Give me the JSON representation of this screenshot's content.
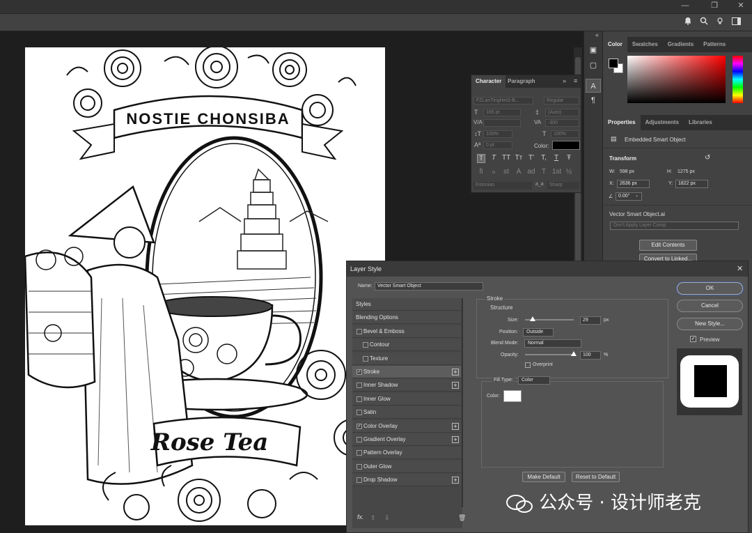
{
  "window": {
    "min": "—",
    "restore": "❐",
    "close": "✕"
  },
  "canvas": {
    "banner_text": "NOSTIE CHONSIBA",
    "tagline": "Rose Tea"
  },
  "tools": [
    "▣",
    "▢",
    "A",
    "¶"
  ],
  "character": {
    "tabs": [
      "Character",
      "Paragraph"
    ],
    "font_family": "FZLanTingHeiS-B...",
    "font_style": "Regular",
    "size": "165 pt",
    "leading": "(Auto)",
    "kerning": "",
    "tracking": "-300",
    "vscale": "100%",
    "hscale": "100%",
    "baseline": "0 pt",
    "color_label": "Color:",
    "language": "Estonian",
    "aa": "a_a",
    "antialias": "Sharp",
    "style_glyphs": [
      "T",
      "T",
      "TT",
      "Tт",
      "T'",
      "T,",
      "T",
      "Ŧ"
    ],
    "ot_glyphs": [
      "fi",
      "ℴ",
      "st",
      "A",
      "ad",
      "T",
      "1st",
      "½"
    ]
  },
  "color_panel": {
    "tabs": [
      "Color",
      "Swatches",
      "Gradients",
      "Patterns"
    ]
  },
  "properties": {
    "tabs": [
      "Properties",
      "Adjustments",
      "Libraries"
    ],
    "type": "Embedded Smart Object",
    "transform_label": "Transform",
    "w_label": "W:",
    "w": "598 px",
    "h_label": "H:",
    "h": "1275 px",
    "x_label": "X:",
    "x": "2636 px",
    "y_label": "Y:",
    "y": "1822 px",
    "angle": "0.00°",
    "file": "Vector Smart Object.ai",
    "layer_comp": "Don't Apply Layer Comp",
    "edit_contents": "Edit Contents",
    "convert": "Convert to Linked..."
  },
  "dialog": {
    "title": "Layer Style",
    "name_label": "Name:",
    "name_value": "Vector Smart Object",
    "styles": [
      {
        "label": "Styles",
        "checkbox": false,
        "checked": false,
        "plus": false,
        "indent": 0
      },
      {
        "label": "Blending Options",
        "checkbox": false,
        "checked": false,
        "plus": false,
        "indent": 0
      },
      {
        "label": "Bevel & Emboss",
        "checkbox": true,
        "checked": false,
        "plus": false,
        "indent": 0
      },
      {
        "label": "Contour",
        "checkbox": true,
        "checked": false,
        "plus": false,
        "indent": 1
      },
      {
        "label": "Texture",
        "checkbox": true,
        "checked": false,
        "plus": false,
        "indent": 1
      },
      {
        "label": "Stroke",
        "checkbox": true,
        "checked": true,
        "plus": true,
        "indent": 0,
        "selected": true
      },
      {
        "label": "Inner Shadow",
        "checkbox": true,
        "checked": false,
        "plus": true,
        "indent": 0
      },
      {
        "label": "Inner Glow",
        "checkbox": true,
        "checked": false,
        "plus": false,
        "indent": 0
      },
      {
        "label": "Satin",
        "checkbox": true,
        "checked": false,
        "plus": false,
        "indent": 0
      },
      {
        "label": "Color Overlay",
        "checkbox": true,
        "checked": true,
        "plus": true,
        "indent": 0
      },
      {
        "label": "Gradient Overlay",
        "checkbox": true,
        "checked": false,
        "plus": true,
        "indent": 0
      },
      {
        "label": "Pattern Overlay",
        "checkbox": true,
        "checked": false,
        "plus": false,
        "indent": 0
      },
      {
        "label": "Outer Glow",
        "checkbox": true,
        "checked": false,
        "plus": false,
        "indent": 0
      },
      {
        "label": "Drop Shadow",
        "checkbox": true,
        "checked": false,
        "plus": true,
        "indent": 0
      }
    ],
    "fx": "fx.",
    "stroke": {
      "heading": "Stroke",
      "structure": "Structure",
      "size_label": "Size:",
      "size": "29",
      "size_unit": "px",
      "size_level": 0.1,
      "position_label": "Position:",
      "position": "Outside",
      "blend_label": "Blend Mode:",
      "blend": "Normal",
      "opacity_label": "Opacity:",
      "opacity": "100",
      "opacity_unit": "%",
      "opacity_level": 1.0,
      "overprint": "Overprint",
      "fill_type_label": "Fill Type:",
      "fill_type": "Color",
      "color_label": "Color:"
    },
    "make_default": "Make Default",
    "reset_default": "Reset to Default",
    "ok": "OK",
    "cancel": "Cancel",
    "new_style": "New Style...",
    "preview": "Preview"
  },
  "watermark": "公众号 · 设计师老克",
  "colors": {
    "accent": "#3d5b9c",
    "swatch_fg": "#000000"
  }
}
